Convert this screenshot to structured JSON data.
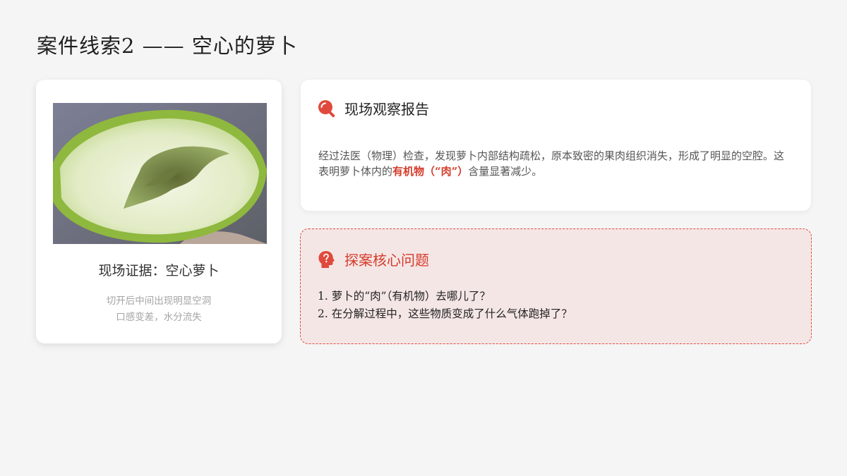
{
  "page": {
    "title": "案件线索2 —— 空心的萝卜"
  },
  "evidence": {
    "image_alt": "切开的空心萝卜",
    "title": "现场证据：空心萝卜",
    "desc_line1": "切开后中间出现明显空洞",
    "desc_line2": "口感变差，水分流失"
  },
  "report": {
    "heading": "现场观察报告",
    "icon": "magnifier-icon",
    "text_before": "经过法医（物理）检查，发现萝卜内部结构疏松，原本致密的果肉组织消失，形成了明显的空腔。这表明萝卜体内的",
    "highlight": "有机物（“肉”）",
    "text_after": "含量显著减少。"
  },
  "questions": {
    "heading": "探案核心问题",
    "icon": "question-head-icon",
    "items": [
      "1.  萝卜的“肉”（有机物）去哪儿了？",
      "2.  在分解过程中，这些物质变成了什么气体跑掉了？"
    ]
  },
  "colors": {
    "accent": "#d63b2a",
    "question_bg": "#f5e6e6",
    "page_bg": "#f5f5f5"
  }
}
